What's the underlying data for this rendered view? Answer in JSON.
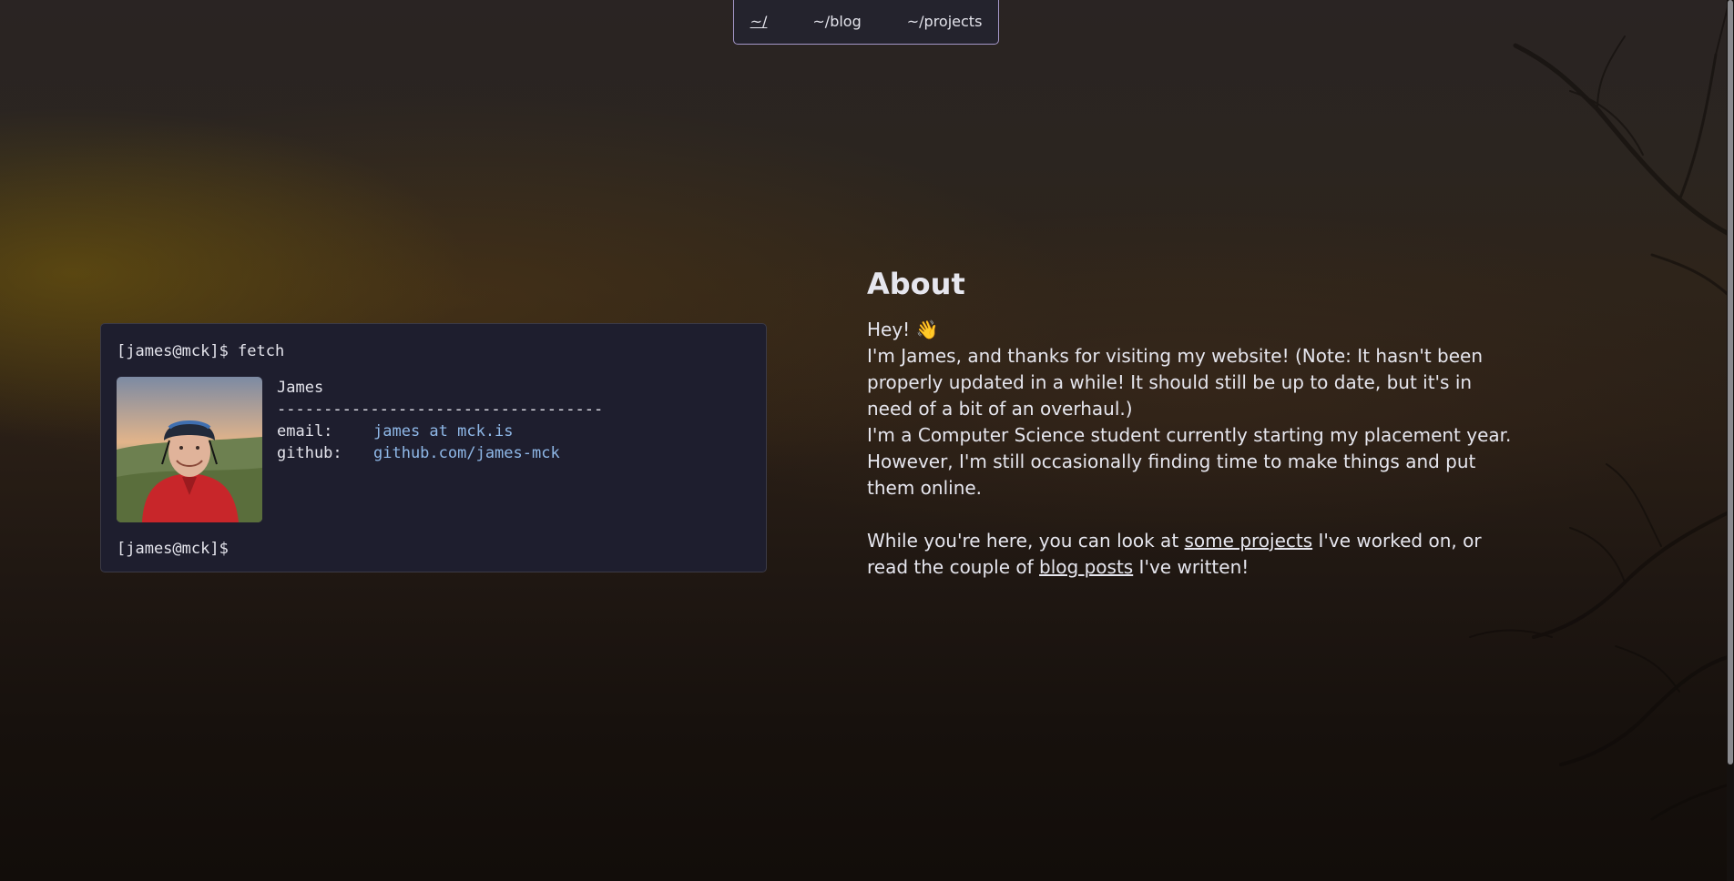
{
  "nav": {
    "items": [
      {
        "label": "~/",
        "active": true
      },
      {
        "label": "~/blog",
        "active": false
      },
      {
        "label": "~/projects",
        "active": false
      }
    ]
  },
  "terminal": {
    "prompt_command": "[james@mck]$ fetch",
    "name": "James",
    "separator": "-----------------------------------",
    "email_key": "email:",
    "email_value": "james at mck.is",
    "github_key": "github:",
    "github_value": "github.com/james-mck",
    "prompt_end": "[james@mck]$",
    "avatar_icon": "profile-photo"
  },
  "about": {
    "title": "About",
    "greeting": "Hey! 👋",
    "para1": "I'm James, and thanks for visiting my website! (Note: It hasn't been properly updated in a while! It should still be up to date, but it's in need of a bit of an overhaul.)",
    "para2": "I'm a Computer Science student currently starting my placement year. However, I'm still occasionally finding time to make things and put them online.",
    "para3_a": "While you're here, you can look at ",
    "projects_link": "some projects",
    "para3_b": " I've worked on, or read the couple of ",
    "blog_link": "blog posts",
    "para3_c": " I've written!"
  },
  "colors": {
    "accent_border": "#a497c9",
    "terminal_bg": "#1e1e2e",
    "link_blue": "#8fb8e8"
  }
}
